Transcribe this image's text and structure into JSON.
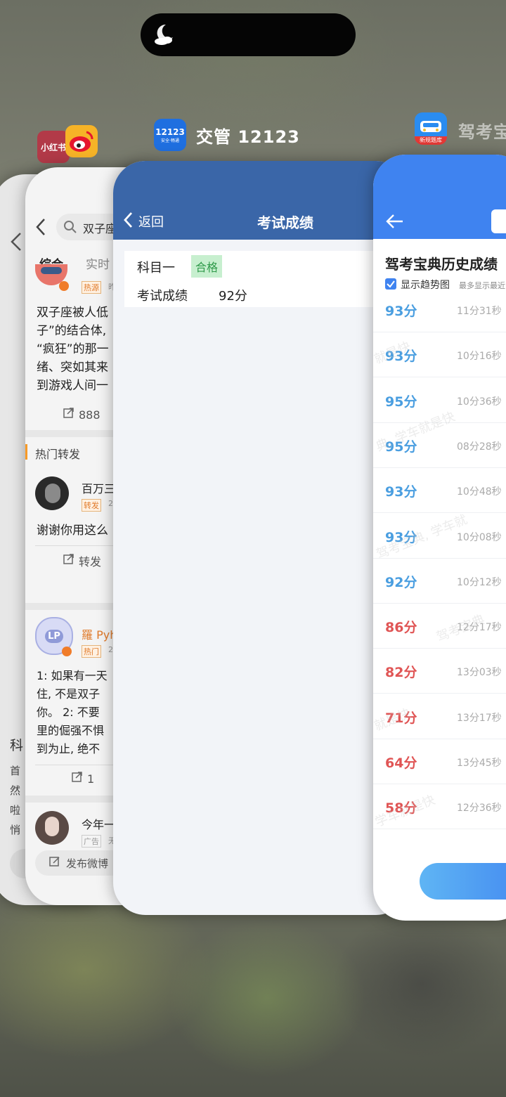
{
  "island": {
    "icon": "moon-cloud-icon"
  },
  "labels": {
    "xhs": {
      "icon_text": "小红书",
      "color": "#b23a48"
    },
    "weibo": {
      "icon": "weibo-icon",
      "color": "#f6b327"
    },
    "jg": {
      "icon_text": "12123",
      "icon_sub": "安全·畅通",
      "name": "交管 12123",
      "color": "#1f6fe0"
    },
    "jk": {
      "icon_badge": "新规题库",
      "name": "驾考宝典",
      "color": "#2a8cf0"
    }
  },
  "xhs_card": {
    "back_icon": "chevron-left-icon",
    "lines": [
      "科",
      "首",
      "然",
      "啦",
      "悄"
    ]
  },
  "weibo_card": {
    "search_text": "双子座",
    "tabs": [
      "综合",
      "实时"
    ],
    "post1": {
      "badge": "热源",
      "time": "昨",
      "lines": [
        "双子座被人低",
        "子”的结合体,",
        "“疯狂”的那一",
        "绪、突如其来",
        "到游戏人间一"
      ],
      "repost_count": "888"
    },
    "section_title": "热门转发",
    "post2": {
      "name": "百万三",
      "badge": "转发",
      "time": "2",
      "text": "谢谢你用这么",
      "repost_label": "转发"
    },
    "post3": {
      "name": "羅 Pyh",
      "badge": "热门",
      "time": "2",
      "lines": [
        "1: 如果有一天",
        "住, 不是双子",
        "你。 2: 不要",
        "里的倔强不惧",
        "到为止, 绝不"
      ],
      "repost_count": "1"
    },
    "post4": {
      "name": "今年一",
      "badge": "广告",
      "extra": "无"
    },
    "compose_label": "发布微博"
  },
  "jg_card": {
    "back_label": "返回",
    "title": "考试成绩",
    "subject": "科目一",
    "status": "合格",
    "score_label": "考试成绩",
    "score": "92分"
  },
  "jk_card": {
    "title": "驾考宝典历史成绩",
    "checkbox_label": "显示趋势图",
    "note": "最多显示最近",
    "records": [
      {
        "score": "93分",
        "time": "11分31秒",
        "pass": true
      },
      {
        "score": "93分",
        "time": "10分16秒",
        "pass": true
      },
      {
        "score": "95分",
        "time": "10分36秒",
        "pass": true
      },
      {
        "score": "95分",
        "time": "08分28秒",
        "pass": true
      },
      {
        "score": "93分",
        "time": "10分48秒",
        "pass": true
      },
      {
        "score": "93分",
        "time": "10分08秒",
        "pass": true
      },
      {
        "score": "92分",
        "time": "10分12秒",
        "pass": true
      },
      {
        "score": "86分",
        "time": "12分17秒",
        "pass": false
      },
      {
        "score": "82分",
        "time": "13分03秒",
        "pass": false
      },
      {
        "score": "71分",
        "time": "13分17秒",
        "pass": false
      },
      {
        "score": "64分",
        "time": "13分45秒",
        "pass": false
      },
      {
        "score": "58分",
        "time": "12分36秒",
        "pass": false
      }
    ],
    "watermarks": [
      "就是快",
      "典, 学车就是快",
      "驾考宝典, 学车就",
      "驾考宝典",
      "就是快",
      "学车就是快"
    ]
  },
  "colors": {
    "pass": "#4a9ee0",
    "fail": "#e05555",
    "jg_header": "#3a66a8",
    "jk_header": "#3f83f0"
  }
}
